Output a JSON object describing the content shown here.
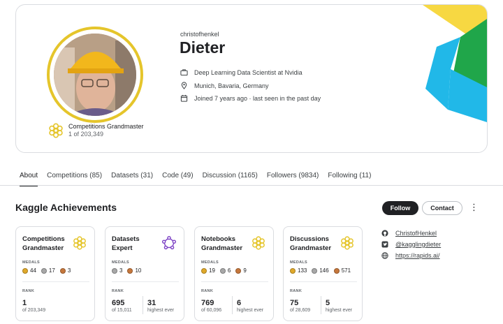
{
  "profile": {
    "handle": "christofhenkel",
    "name": "Dieter",
    "occupation": "Deep Learning Data Scientist at Nvidia",
    "location": "Munich, Bavaria, Germany",
    "joined": "Joined 7 years ago · last seen in the past day",
    "tier": "Competitions Grandmaster",
    "tier_rank": "1 of 203,349"
  },
  "tabs": [
    {
      "label": "About",
      "active": true
    },
    {
      "label": "Competitions (85)"
    },
    {
      "label": "Datasets (31)"
    },
    {
      "label": "Code (49)"
    },
    {
      "label": "Discussion (1165)"
    },
    {
      "label": "Followers (9834)"
    },
    {
      "label": "Following (11)"
    }
  ],
  "section_title": "Kaggle Achievements",
  "actions": {
    "follow": "Follow",
    "contact": "Contact",
    "more": "⋮"
  },
  "links": [
    {
      "icon": "github-icon",
      "text": "ChristofHenkel"
    },
    {
      "icon": "twitter-icon",
      "text": "@kagglingdieter"
    },
    {
      "icon": "globe-icon",
      "text": "https://rapids.ai/"
    }
  ],
  "labels": {
    "medals": "MEDALS",
    "rank": "RANK",
    "highest_ever": "highest ever"
  },
  "colors": {
    "gold": "#e0a92a",
    "silver": "#a8a8a8",
    "bronze": "#c6773c",
    "grandmaster": "#e5c52b",
    "expert": "#7b3fc4"
  },
  "achievements": [
    {
      "line1": "Competitions",
      "line2": "Grandmaster",
      "icon": "grandmaster-icon",
      "gold": "44",
      "silver": "17",
      "bronze": "3",
      "rank": "1",
      "rank_of": "of 203,349",
      "highest": "",
      "highest_label": ""
    },
    {
      "line1": "Datasets",
      "line2": "Expert",
      "icon": "expert-icon",
      "gold": "",
      "silver": "3",
      "bronze": "10",
      "rank": "695",
      "rank_of": "of 15,011",
      "highest": "31",
      "highest_label": "highest ever"
    },
    {
      "line1": "Notebooks",
      "line2": "Grandmaster",
      "icon": "grandmaster-icon",
      "gold": "19",
      "silver": "6",
      "bronze": "9",
      "rank": "769",
      "rank_of": "of 60,096",
      "highest": "6",
      "highest_label": "highest ever"
    },
    {
      "line1": "Discussions",
      "line2": "Grandmaster",
      "icon": "grandmaster-icon",
      "gold": "133",
      "silver": "146",
      "bronze": "571",
      "rank": "75",
      "rank_of": "of 28,609",
      "highest": "5",
      "highest_label": "highest ever"
    }
  ]
}
